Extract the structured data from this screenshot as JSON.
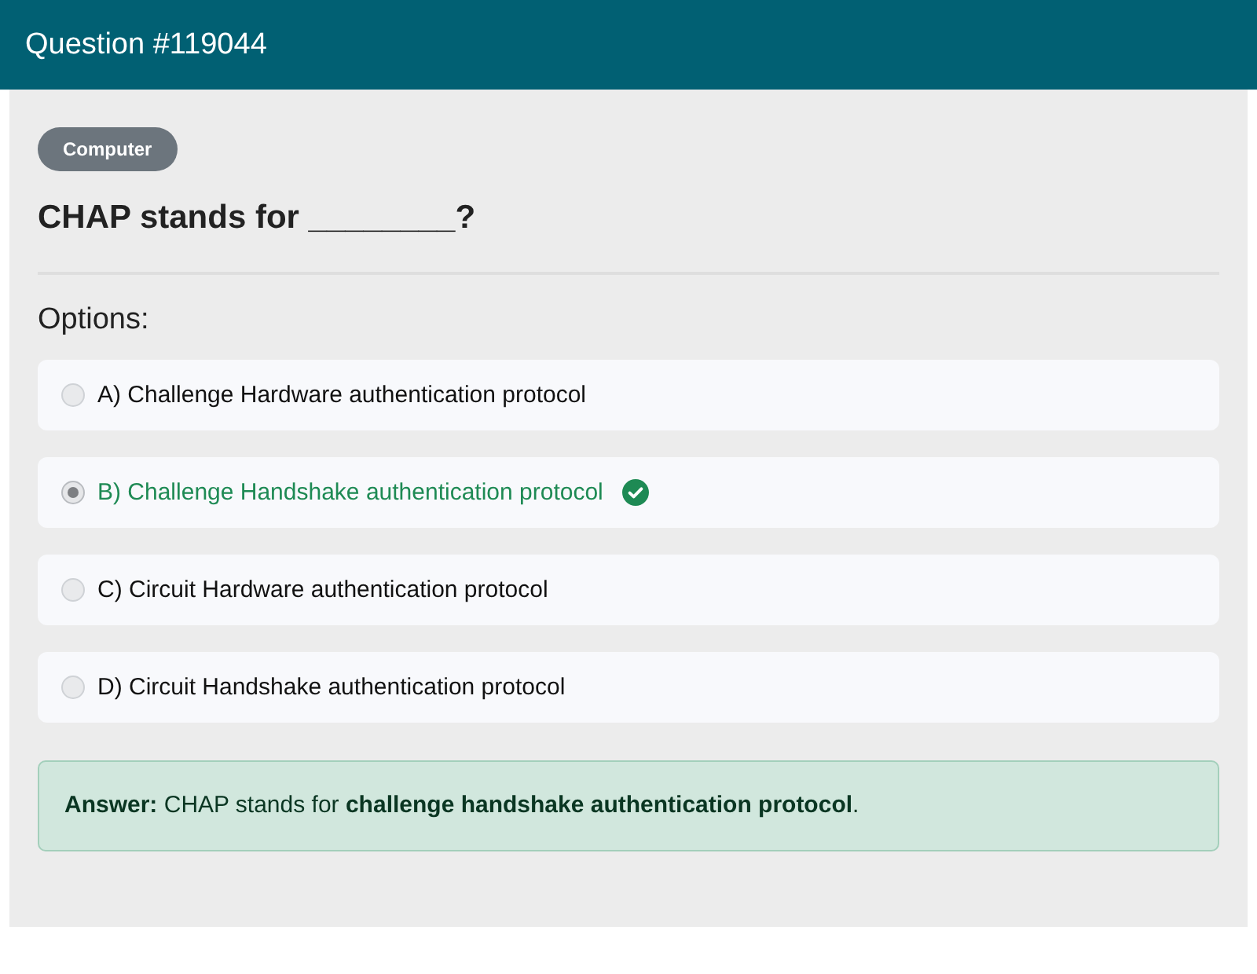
{
  "header": {
    "title": "Question #119044"
  },
  "category": "Computer",
  "question": "CHAP stands for ________?",
  "options_label": "Options:",
  "options": [
    {
      "text": "A) Challenge Hardware authentication protocol",
      "selected": false,
      "correct": false
    },
    {
      "text": "B) Challenge Handshake authentication protocol",
      "selected": true,
      "correct": true
    },
    {
      "text": "C) Circuit Hardware authentication protocol",
      "selected": false,
      "correct": false
    },
    {
      "text": "D) Circuit Handshake authentication protocol",
      "selected": false,
      "correct": false
    }
  ],
  "answer": "**Answer:** CHAP stands for **challenge handshake authentication protocol**."
}
